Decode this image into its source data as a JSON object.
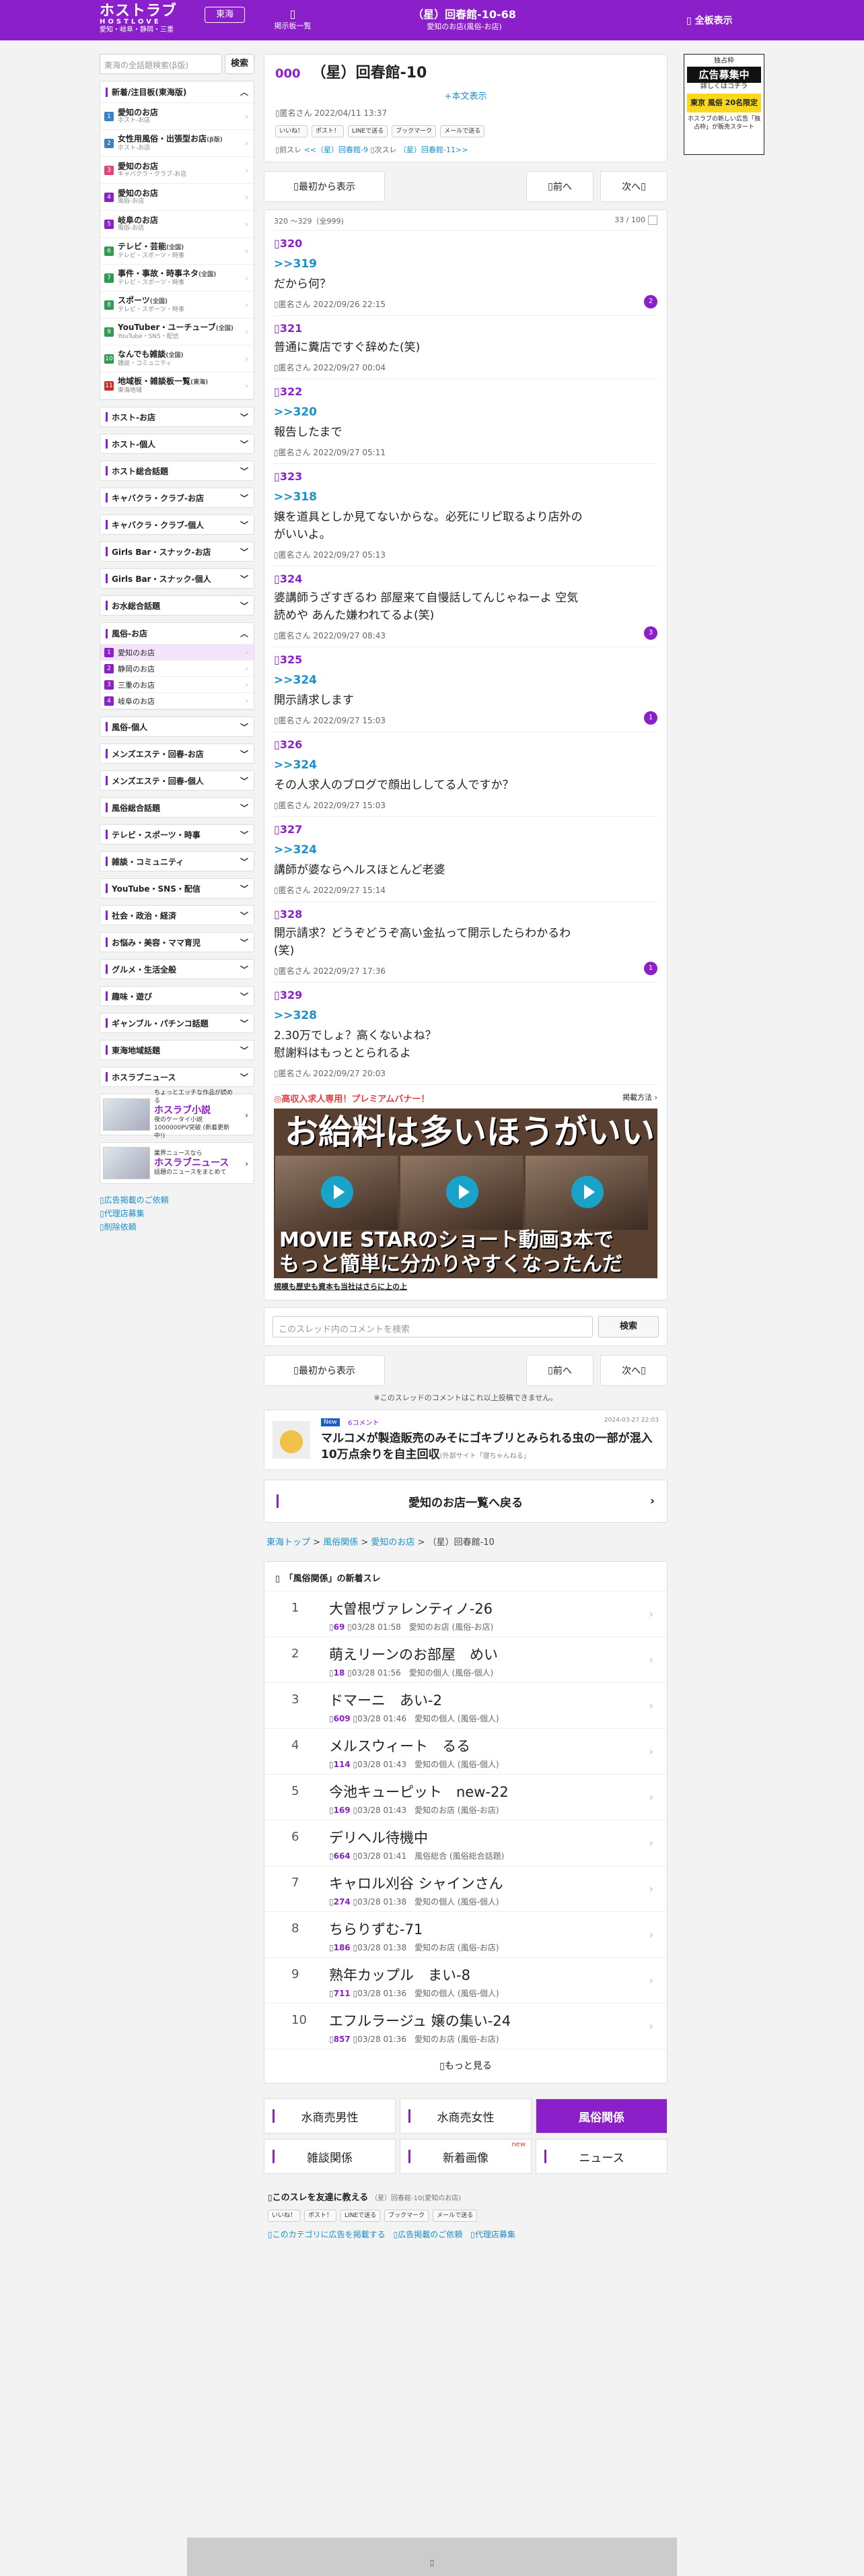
{
  "header": {
    "logo": "ホストラブ",
    "logo_sub": "HOSTLOVE",
    "logo_area": "愛知・岐阜・静岡・三重",
    "region_button": "東海",
    "board_list": "掲示板一覧",
    "title": "（星）回春館-10-68",
    "subtitle": "愛知のお店(風俗-お店)",
    "all_display": "全板表示",
    "accent": "#8b1fc9"
  },
  "sidebar": {
    "search_placeholder": "東海の全話題検索(β版)",
    "search_button": "検索",
    "new_section": "新着/注目板(東海版)",
    "new_items": [
      {
        "n": "1",
        "label": "愛知のお店",
        "desc": "ホスト-お店",
        "color": "#3b82c4"
      },
      {
        "n": "2",
        "label": "女性用風俗・出張型お店",
        "desc": "ホスト-お店",
        "color": "#3b82c4",
        "tag": "(β版)"
      },
      {
        "n": "3",
        "label": "愛知のお店",
        "desc": "キャバクラ・クラブ-お店",
        "color": "#e0457b"
      },
      {
        "n": "4",
        "label": "愛知のお店",
        "desc": "風俗-お店",
        "color": "#8b1fc9"
      },
      {
        "n": "5",
        "label": "岐阜のお店",
        "desc": "風俗-お店",
        "color": "#8b1fc9"
      },
      {
        "n": "6",
        "label": "テレビ・芸能",
        "desc": "テレビ・スポーツ・時事",
        "color": "#2e9b50",
        "tag": "(全国)"
      },
      {
        "n": "7",
        "label": "事件・事故・時事ネタ",
        "desc": "テレビ・スポーツ・時事",
        "color": "#2e9b50",
        "tag": "(全国)"
      },
      {
        "n": "8",
        "label": "スポーツ",
        "desc": "テレビ・スポーツ・時事",
        "color": "#2e9b50",
        "tag": "(全国)"
      },
      {
        "n": "9",
        "label": "YouTuber・ユーチューブ",
        "desc": "YouTube・SNS・配信",
        "color": "#2e9b50",
        "tag": "(全国)"
      },
      {
        "n": "10",
        "label": "なんでも雑談",
        "desc": "雑談・コミュニティ",
        "color": "#2e9b50",
        "tag": "(全国)"
      },
      {
        "n": "11",
        "label": "地域板・雑談板一覧",
        "desc": "東海地域",
        "color": "#c5302f",
        "tag": "(東海)"
      }
    ],
    "sections_a": [
      "ホスト-お店",
      "ホスト-個人",
      "ホスト総合話題",
      "キャバクラ・クラブ-お店",
      "キャバクラ・クラブ-個人",
      "Girls Bar・スナック-お店",
      "Girls Bar・スナック-個人",
      "お水総合話題"
    ],
    "fuzoku_head": "風俗-お店",
    "fuzoku_items": [
      {
        "n": "1",
        "label": "愛知のお店",
        "color": "#8b1fc9"
      },
      {
        "n": "2",
        "label": "静岡のお店",
        "color": "#8b1fc9"
      },
      {
        "n": "3",
        "label": "三重のお店",
        "color": "#8b1fc9"
      },
      {
        "n": "4",
        "label": "岐阜のお店",
        "color": "#8b1fc9"
      }
    ],
    "sections_b": [
      "風俗-個人",
      "メンズエステ・回春-お店",
      "メンズエステ・回春-個人",
      "風俗総合話題",
      "テレビ・スポーツ・時事",
      "雑談・コミュニティ",
      "YouTube・SNS・配信",
      "社会・政治・経済",
      "お悩み・美容・ママ育児",
      "グルメ・生活全般",
      "趣味・遊び",
      "ギャンブル・パチンコ話題",
      "東海地域話題",
      "ホスラブニュース"
    ],
    "ad1_small": "ちょっとエッチな作品が読める",
    "ad1_title": "ホスラブ小説",
    "ad1_desc": "夜のケータイ小説 1000000PV突破 (新着更新中!)",
    "ad2_small": "業界ニュースなら",
    "ad2_title": "ホスラブニュース",
    "ad2_desc": "話題のニュースをまとめて",
    "links": [
      "広告掲載のご依頼",
      "代理店募集",
      "削除依頼"
    ]
  },
  "right_ad": {
    "top": "独占枠",
    "big": "広告募集中",
    "mid": "詳しくはコチラ",
    "yellow": "東京 風俗 20名限定",
    "desc": "ホスラブの新しい広告「独占枠」が販売スタート"
  },
  "thread": {
    "no": "000",
    "title": "（星）回春館-10",
    "body_link": "+本文表示",
    "meta": "匿名さん 2022/04/11 13:37",
    "share": [
      "いいね！",
      "ポスト！",
      "LINEで送る",
      "ブックマーク",
      "メールで送る"
    ],
    "prev_label": "前スレ",
    "prev_link": "<<（星）回春館-9",
    "next_label": "次スレ",
    "next_link": "（星）回春館-11>>"
  },
  "pager": {
    "first": "最初から表示",
    "prev": "前へ",
    "next": "次へ"
  },
  "posts_range": "320 〜329（全999)",
  "posts_page": "33 / 100",
  "posts": [
    {
      "no": "320",
      "reply": ">>319",
      "body": "だから何？",
      "meta": "匿名さん 2022/09/26 22:15",
      "count": "2"
    },
    {
      "no": "321",
      "reply": "",
      "body": "普通に糞店ですぐ辞めた(笑)",
      "meta": "匿名さん 2022/09/27 00:04",
      "count": ""
    },
    {
      "no": "322",
      "reply": ">>320",
      "body": "報告したまで",
      "meta": "匿名さん 2022/09/27 05:11",
      "count": ""
    },
    {
      "no": "323",
      "reply": ">>318",
      "body": "嬢を道具としか見てないからな。必死にリピ取るより店外の\nがいいよ。",
      "meta": "匿名さん 2022/09/27 05:13",
      "count": ""
    },
    {
      "no": "324",
      "reply": "",
      "body": "婆講師うざすぎるわ 部屋来て自慢話してんじゃねーよ 空気\n読めや あんた嫌われてるよ(笑)",
      "meta": "匿名さん 2022/09/27 08:43",
      "count": "3"
    },
    {
      "no": "325",
      "reply": ">>324",
      "body": "開示請求します",
      "meta": "匿名さん 2022/09/27 15:03",
      "count": "1"
    },
    {
      "no": "326",
      "reply": ">>324",
      "body": "その人求人のブログで顔出ししてる人ですか？",
      "meta": "匿名さん 2022/09/27 15:03",
      "count": ""
    },
    {
      "no": "327",
      "reply": ">>324",
      "body": "講師が婆ならヘルスほとんど老婆",
      "meta": "匿名さん 2022/09/27 15:14",
      "count": ""
    },
    {
      "no": "328",
      "reply": "",
      "body": "開示請求？どうぞどうぞ高い金払って開示したらわかるわ\n(笑)",
      "meta": "匿名さん 2022/09/27 17:36",
      "count": "1"
    },
    {
      "no": "329",
      "reply": ">>328",
      "body": "2.30万でしょ？高くないよね？\n慰謝料はもっととられるよ",
      "meta": "匿名さん 2022/09/27 20:03",
      "count": ""
    }
  ],
  "banner": {
    "head": "◎高収入求人専用！プレミアムバナー！",
    "head_right": "掲載方法",
    "line1": "お給料は多いほうがいい",
    "line2": "MOVIE STARのショート動画3本で\nもっと簡単に分かりやすくなったんだ",
    "foot": "規模も歴史も資本も当社はさらに上の上"
  },
  "comment_search": {
    "placeholder": "このスレッド内のコメントを検索",
    "button": "検索"
  },
  "notice": "※このスレッドのコメントはこれ以上投稿できません。",
  "news": {
    "badge": "New",
    "comments": "6コメント",
    "date": "2024-03-27 22:03",
    "headline": "マルコメが製造販売のみそにゴキブリとみられる虫の一部が混入 10万点余りを自主回収",
    "source": "(外部サイト「寝ちゃんねる」"
  },
  "back_link": "愛知のお店一覧へ戻る",
  "breadcrumb": [
    "東海トップ",
    "風俗関係",
    "愛知のお店",
    "（星）回春館-10"
  ],
  "new_threads_head": "「風俗関係」の新着スレ",
  "new_threads": [
    {
      "rank": "1",
      "title": "大曽根ヴァレンティノ-26",
      "count": "69",
      "time": "03/28 01:58",
      "board": "愛知のお店 (風俗-お店)"
    },
    {
      "rank": "2",
      "title": "萌えリーンのお部屋　めい",
      "count": "18",
      "time": "03/28 01:56",
      "board": "愛知の個人 (風俗-個人)"
    },
    {
      "rank": "3",
      "title": "ドマーニ　あい-2",
      "count": "609",
      "time": "03/28 01:46",
      "board": "愛知の個人 (風俗-個人)"
    },
    {
      "rank": "4",
      "title": "メルスウィート　るる",
      "count": "114",
      "time": "03/28 01:43",
      "board": "愛知の個人 (風俗-個人)"
    },
    {
      "rank": "5",
      "title": "今池キューピット　new-22",
      "count": "169",
      "time": "03/28 01:43",
      "board": "愛知のお店 (風俗-お店)"
    },
    {
      "rank": "6",
      "title": "デリヘル待機中",
      "count": "664",
      "time": "03/28 01:41",
      "board": "風俗総合 (風俗総合話題)"
    },
    {
      "rank": "7",
      "title": "キャロル刈谷 シャインさん",
      "count": "274",
      "time": "03/28 01:38",
      "board": "愛知の個人 (風俗-個人)"
    },
    {
      "rank": "8",
      "title": "ちらりずむ-71",
      "count": "186",
      "time": "03/28 01:38",
      "board": "愛知のお店 (風俗-お店)"
    },
    {
      "rank": "9",
      "title": "熟年カップル　まい-8",
      "count": "711",
      "time": "03/28 01:36",
      "board": "愛知の個人 (風俗-個人)"
    },
    {
      "rank": "10",
      "title": "エフルラージュ 嬢の集い-24",
      "count": "857",
      "time": "03/28 01:36",
      "board": "愛知のお店 (風俗-お店)"
    }
  ],
  "more": "もっと見る",
  "category_tabs": [
    {
      "label": "水商売男性",
      "on": false,
      "new": ""
    },
    {
      "label": "水商売女性",
      "on": false,
      "new": ""
    },
    {
      "label": "風俗関係",
      "on": true,
      "new": ""
    },
    {
      "label": "雑談関係",
      "on": false,
      "new": ""
    },
    {
      "label": "新着画像",
      "on": false,
      "new": "new"
    },
    {
      "label": "ニュース",
      "on": false,
      "new": ""
    }
  ],
  "share_foot": {
    "label": "このスレを友達に教える",
    "sub": "（星）回春館-10(愛知のお店)",
    "links": [
      "このカテゴリに広告を掲載する",
      "広告掲載のご依頼",
      "代理店募集"
    ]
  }
}
